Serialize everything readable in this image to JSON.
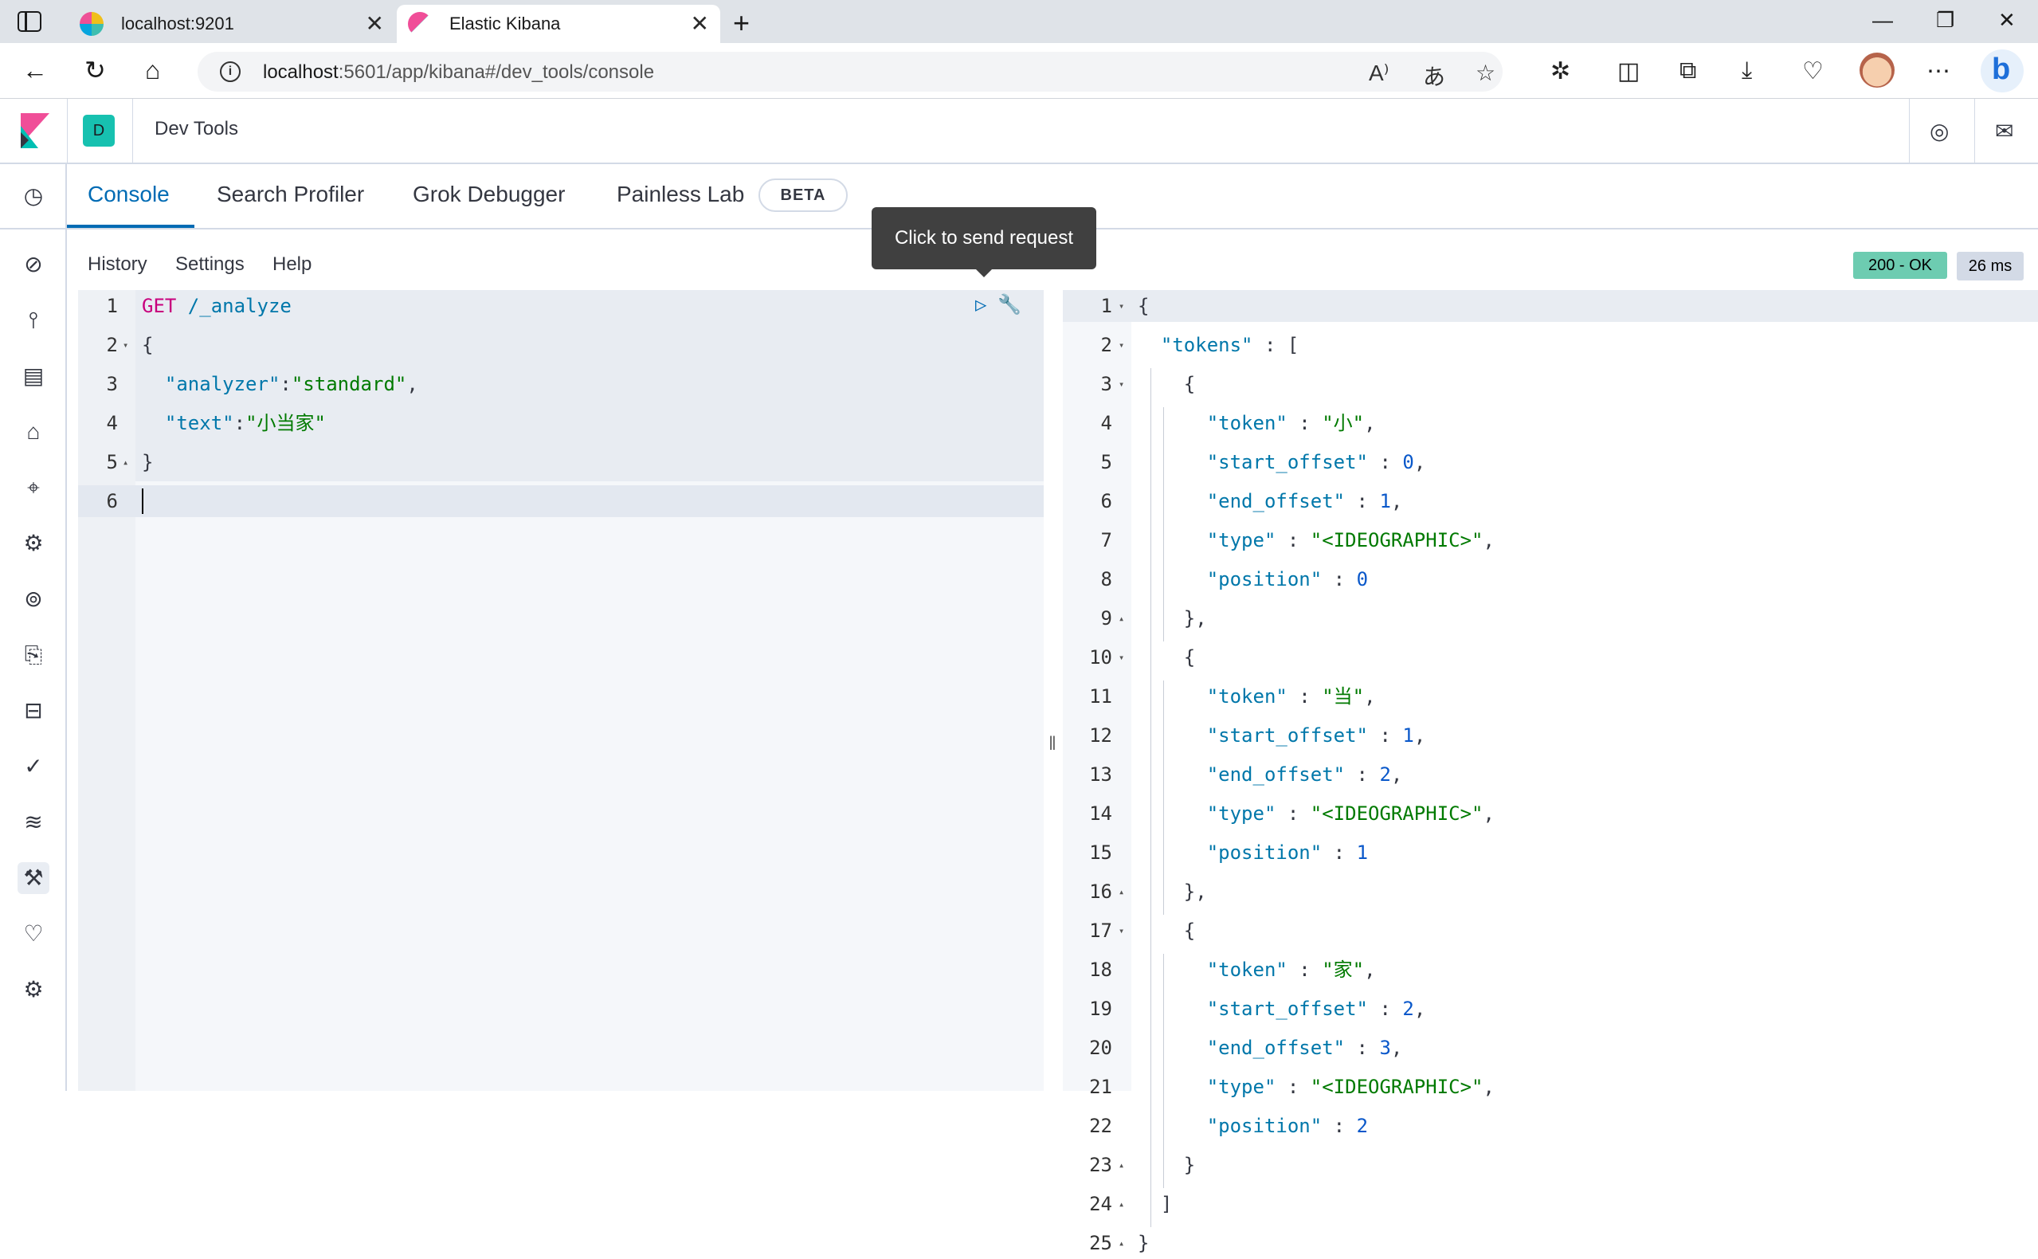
{
  "browser": {
    "tabs": [
      {
        "title": "localhost:9201",
        "favicon": "elasticsearch-favicon",
        "active": false
      },
      {
        "title": "Elastic Kibana",
        "favicon": "kibana-favicon",
        "active": true
      }
    ],
    "url_host": "localhost",
    "url_rest": ":5601/app/kibana#/dev_tools/console"
  },
  "header": {
    "space_initial": "D",
    "title": "Dev Tools"
  },
  "devtools_tabs": [
    "Console",
    "Search Profiler",
    "Grok Debugger",
    "Painless Lab"
  ],
  "beta_label": "BETA",
  "console_menu": [
    "History",
    "Settings",
    "Help"
  ],
  "tooltip": "Click to send request",
  "status": {
    "code": "200 - OK",
    "time": "26 ms"
  },
  "request_lines": [
    {
      "n": "1",
      "fold": "",
      "parts": [
        [
          "m",
          "GET"
        ],
        [
          "",
          ""
        ],
        [
          "k",
          " /_analyze"
        ]
      ]
    },
    {
      "n": "2",
      "fold": "▾",
      "parts": [
        [
          "",
          "{"
        ]
      ]
    },
    {
      "n": "3",
      "fold": "",
      "parts": [
        [
          "",
          "  "
        ],
        [
          "k",
          "\"analyzer\""
        ],
        [
          "",
          ":"
        ],
        [
          "s",
          "\"standard\""
        ],
        [
          "",
          ","
        ]
      ]
    },
    {
      "n": "4",
      "fold": "",
      "parts": [
        [
          "",
          "  "
        ],
        [
          "k",
          "\"text\""
        ],
        [
          "",
          ":"
        ],
        [
          "s",
          "\"小当家\""
        ]
      ]
    },
    {
      "n": "5",
      "fold": "▴",
      "parts": [
        [
          "",
          "}"
        ]
      ]
    },
    {
      "n": "6",
      "fold": "",
      "parts": [
        [
          "",
          ""
        ]
      ]
    }
  ],
  "response_lines": [
    {
      "n": "1",
      "fold": "▾",
      "parts": [
        [
          "",
          "{"
        ]
      ]
    },
    {
      "n": "2",
      "fold": "▾",
      "parts": [
        [
          "",
          "  "
        ],
        [
          "k",
          "\"tokens\""
        ],
        [
          "",
          " : ["
        ]
      ]
    },
    {
      "n": "3",
      "fold": "▾",
      "parts": [
        [
          "",
          "    {"
        ]
      ]
    },
    {
      "n": "4",
      "fold": "",
      "parts": [
        [
          "",
          "      "
        ],
        [
          "k",
          "\"token\""
        ],
        [
          "",
          " : "
        ],
        [
          "s",
          "\"小\""
        ],
        [
          "",
          ","
        ]
      ]
    },
    {
      "n": "5",
      "fold": "",
      "parts": [
        [
          "",
          "      "
        ],
        [
          "k",
          "\"start_offset\""
        ],
        [
          "",
          " : "
        ],
        [
          "n",
          "0"
        ],
        [
          "",
          ","
        ]
      ]
    },
    {
      "n": "6",
      "fold": "",
      "parts": [
        [
          "",
          "      "
        ],
        [
          "k",
          "\"end_offset\""
        ],
        [
          "",
          " : "
        ],
        [
          "n",
          "1"
        ],
        [
          "",
          ","
        ]
      ]
    },
    {
      "n": "7",
      "fold": "",
      "parts": [
        [
          "",
          "      "
        ],
        [
          "k",
          "\"type\""
        ],
        [
          "",
          " : "
        ],
        [
          "s",
          "\"<IDEOGRAPHIC>\""
        ],
        [
          "",
          ","
        ]
      ]
    },
    {
      "n": "8",
      "fold": "",
      "parts": [
        [
          "",
          "      "
        ],
        [
          "k",
          "\"position\""
        ],
        [
          "",
          " : "
        ],
        [
          "n",
          "0"
        ]
      ]
    },
    {
      "n": "9",
      "fold": "▴",
      "parts": [
        [
          "",
          "    },"
        ]
      ]
    },
    {
      "n": "10",
      "fold": "▾",
      "parts": [
        [
          "",
          "    {"
        ]
      ]
    },
    {
      "n": "11",
      "fold": "",
      "parts": [
        [
          "",
          "      "
        ],
        [
          "k",
          "\"token\""
        ],
        [
          "",
          " : "
        ],
        [
          "s",
          "\"当\""
        ],
        [
          "",
          ","
        ]
      ]
    },
    {
      "n": "12",
      "fold": "",
      "parts": [
        [
          "",
          "      "
        ],
        [
          "k",
          "\"start_offset\""
        ],
        [
          "",
          " : "
        ],
        [
          "n",
          "1"
        ],
        [
          "",
          ","
        ]
      ]
    },
    {
      "n": "13",
      "fold": "",
      "parts": [
        [
          "",
          "      "
        ],
        [
          "k",
          "\"end_offset\""
        ],
        [
          "",
          " : "
        ],
        [
          "n",
          "2"
        ],
        [
          "",
          ","
        ]
      ]
    },
    {
      "n": "14",
      "fold": "",
      "parts": [
        [
          "",
          "      "
        ],
        [
          "k",
          "\"type\""
        ],
        [
          "",
          " : "
        ],
        [
          "s",
          "\"<IDEOGRAPHIC>\""
        ],
        [
          "",
          ","
        ]
      ]
    },
    {
      "n": "15",
      "fold": "",
      "parts": [
        [
          "",
          "      "
        ],
        [
          "k",
          "\"position\""
        ],
        [
          "",
          " : "
        ],
        [
          "n",
          "1"
        ]
      ]
    },
    {
      "n": "16",
      "fold": "▴",
      "parts": [
        [
          "",
          "    },"
        ]
      ]
    },
    {
      "n": "17",
      "fold": "▾",
      "parts": [
        [
          "",
          "    {"
        ]
      ]
    },
    {
      "n": "18",
      "fold": "",
      "parts": [
        [
          "",
          "      "
        ],
        [
          "k",
          "\"token\""
        ],
        [
          "",
          " : "
        ],
        [
          "s",
          "\"家\""
        ],
        [
          "",
          ","
        ]
      ]
    },
    {
      "n": "19",
      "fold": "",
      "parts": [
        [
          "",
          "      "
        ],
        [
          "k",
          "\"start_offset\""
        ],
        [
          "",
          " : "
        ],
        [
          "n",
          "2"
        ],
        [
          "",
          ","
        ]
      ]
    },
    {
      "n": "20",
      "fold": "",
      "parts": [
        [
          "",
          "      "
        ],
        [
          "k",
          "\"end_offset\""
        ],
        [
          "",
          " : "
        ],
        [
          "n",
          "3"
        ],
        [
          "",
          ","
        ]
      ]
    },
    {
      "n": "21",
      "fold": "",
      "parts": [
        [
          "",
          "      "
        ],
        [
          "k",
          "\"type\""
        ],
        [
          "",
          " : "
        ],
        [
          "s",
          "\"<IDEOGRAPHIC>\""
        ],
        [
          "",
          ","
        ]
      ]
    },
    {
      "n": "22",
      "fold": "",
      "parts": [
        [
          "",
          "      "
        ],
        [
          "k",
          "\"position\""
        ],
        [
          "",
          " : "
        ],
        [
          "n",
          "2"
        ]
      ]
    },
    {
      "n": "23",
      "fold": "▴",
      "parts": [
        [
          "",
          "    }"
        ]
      ]
    },
    {
      "n": "24",
      "fold": "▴",
      "parts": [
        [
          "",
          "  ]"
        ]
      ]
    },
    {
      "n": "25",
      "fold": "▴",
      "parts": [
        [
          "",
          "}"
        ]
      ]
    }
  ],
  "nav_icons": [
    "recent-icon",
    "discover-icon",
    "visualize-icon",
    "dashboard-icon",
    "canvas-icon",
    "maps-icon",
    "ml-icon",
    "siem-icon",
    "logs-icon",
    "infrastructure-icon",
    "apm-icon",
    "uptime-icon",
    "dev-tools-icon",
    "monitoring-icon",
    "management-icon"
  ],
  "colors": {
    "accent": "#006bb4",
    "status_ok": "#6dccb1",
    "space_badge": "#17c1b0"
  }
}
